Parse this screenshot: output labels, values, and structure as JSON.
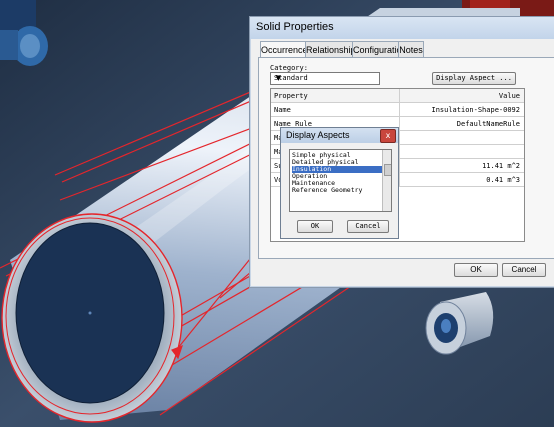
{
  "dialog": {
    "title": "Solid Properties",
    "tabs": [
      "Occurrence",
      "Relationship",
      "Configuration",
      "Notes"
    ],
    "category_label": "Category:",
    "category_value": "Standard",
    "display_aspect_button": "Display Aspect ...",
    "table": {
      "headers": [
        "Property",
        "Value"
      ],
      "rows": [
        [
          "Name",
          "Insulation-Shape-0092"
        ],
        [
          "Name Rule",
          "DefaultNameRule"
        ],
        [
          "Ma",
          ""
        ],
        [
          "Ma",
          ""
        ],
        [
          "Su",
          "11.41 m^2"
        ],
        [
          "Vo",
          "0.41 m^3"
        ]
      ]
    },
    "ok_label": "OK",
    "cancel_label": "Cancel"
  },
  "popup": {
    "title": "Display Aspects",
    "close_glyph": "x",
    "items": [
      "Simple physical",
      "Detailed physical",
      "Insulation",
      "Operation",
      "Maintenance",
      "Reference Geometry"
    ],
    "selected_index": 2,
    "ok_label": "OK",
    "cancel_label": "Cancel"
  },
  "colors": {
    "background": "#2e3f55",
    "highlight": "#e4262c",
    "selection": "#3b6ec4",
    "pipe": "#a9bcd3"
  }
}
